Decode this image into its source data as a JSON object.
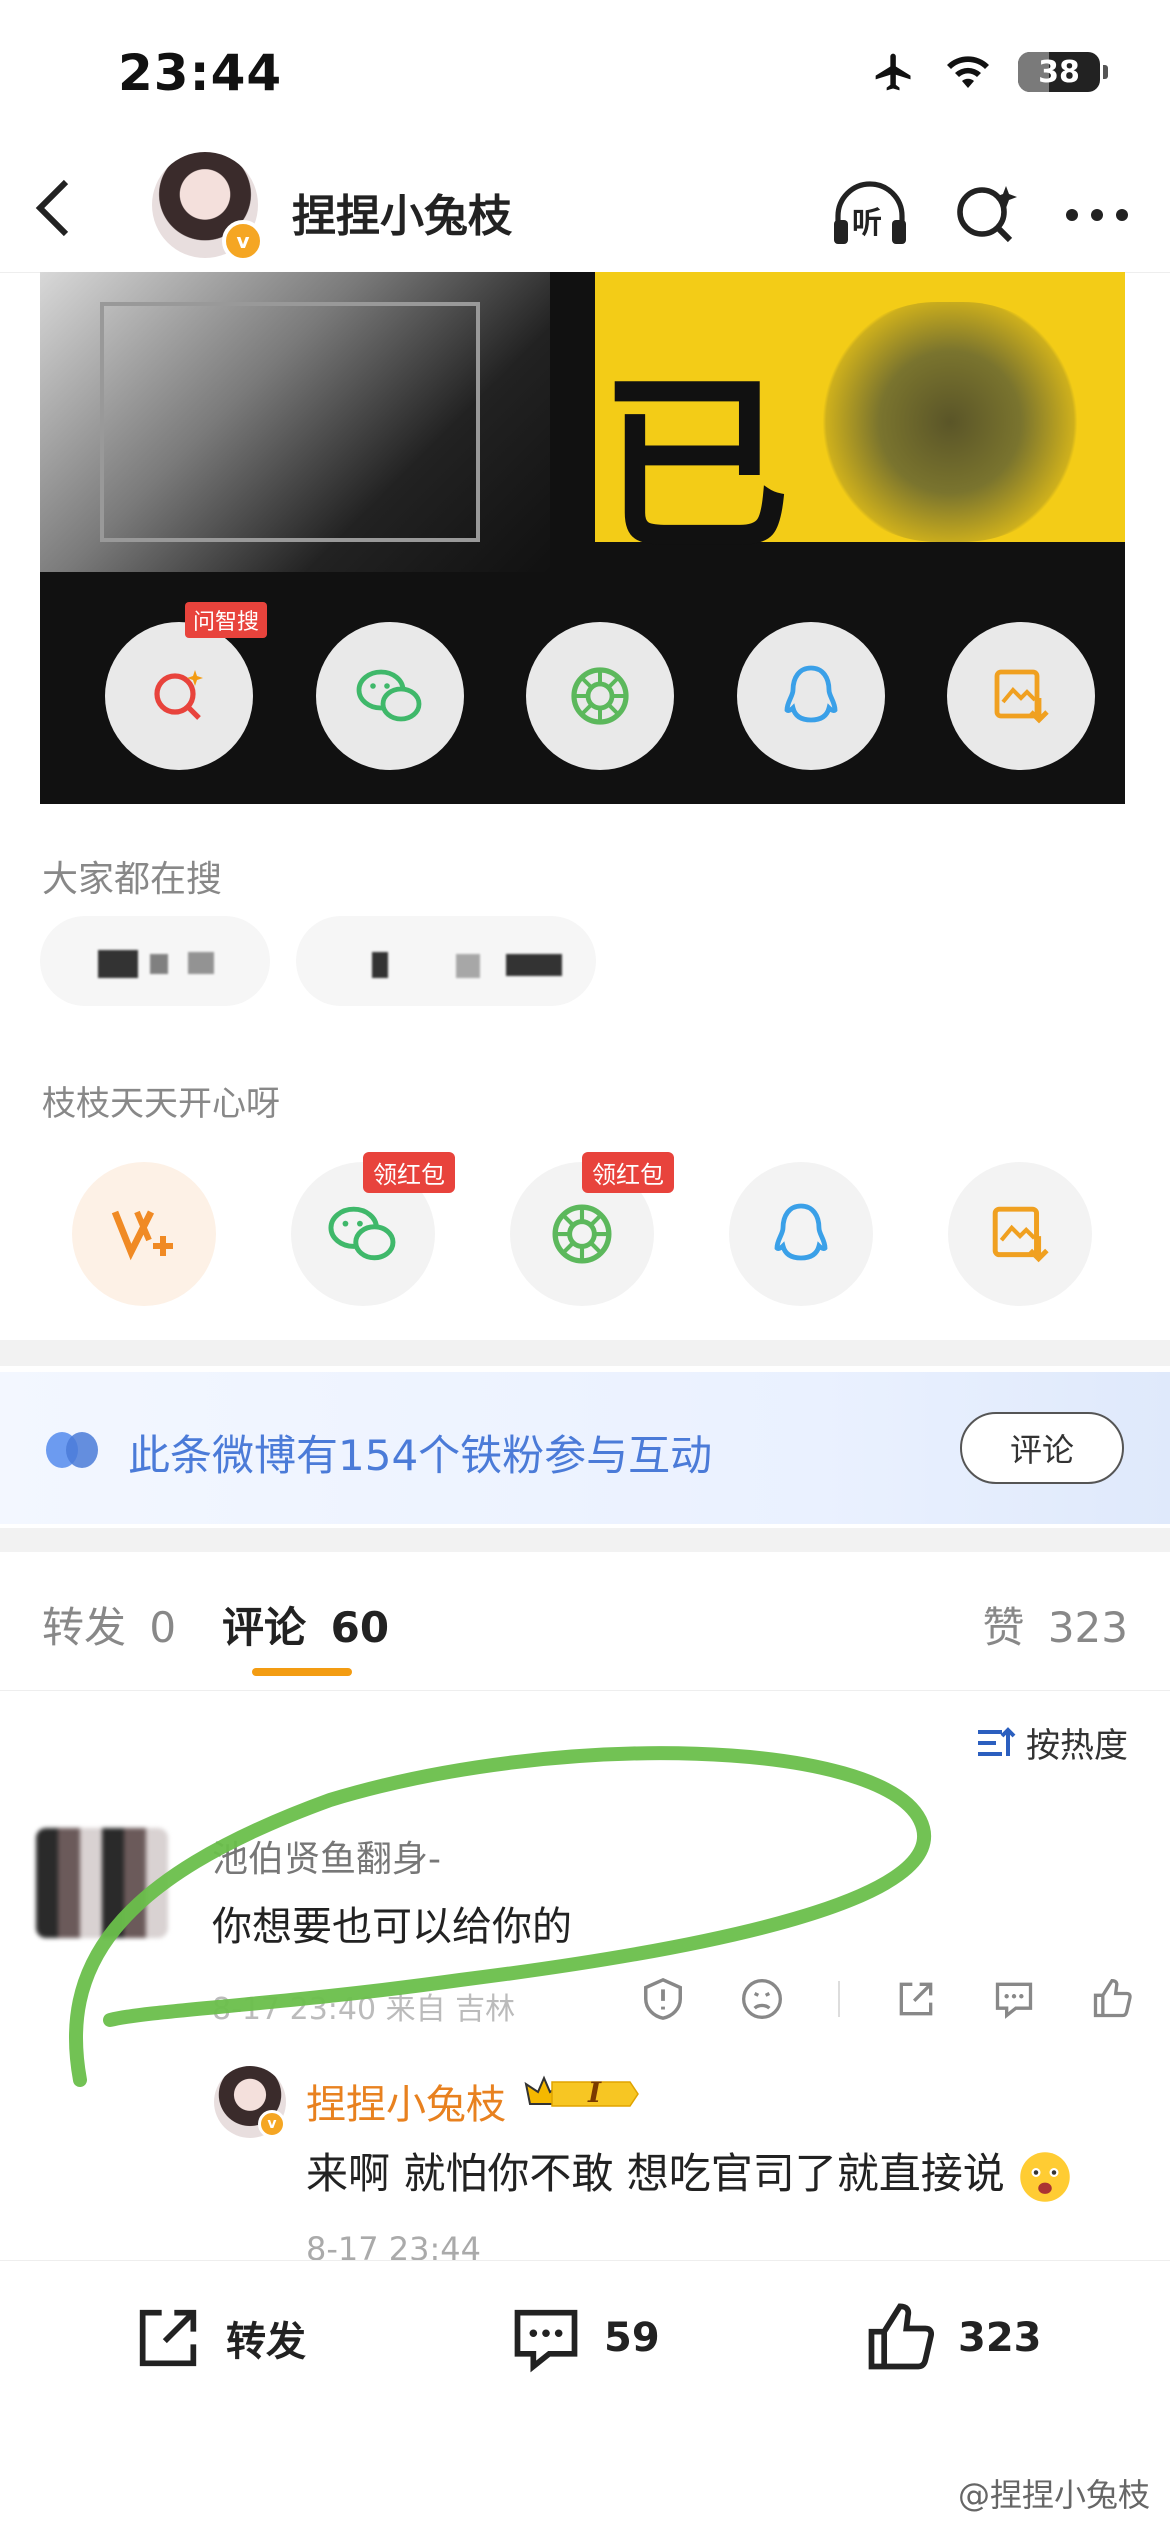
{
  "status_bar": {
    "time": "23:44",
    "battery": "38",
    "battery_level": 0.38
  },
  "header": {
    "username": "捏捏小兔枝",
    "verified_badge": "v",
    "icons": [
      "back-arrow-icon",
      "listen-icon",
      "ai-search-icon",
      "more-icon"
    ],
    "listen_label": "听"
  },
  "media": {
    "poster_text": "已",
    "share_tag": "问智搜",
    "share_icons": [
      "ai-search-icon",
      "wechat-icon",
      "moments-icon",
      "qq-icon",
      "save-image-icon"
    ]
  },
  "search_section": {
    "title": "大家都在搜"
  },
  "share_section": {
    "title": "枝枝天天开心呀",
    "items": [
      {
        "icon": "vplus-icon",
        "tag": ""
      },
      {
        "icon": "wechat-icon",
        "tag": "领红包"
      },
      {
        "icon": "moments-icon",
        "tag": "领红包"
      },
      {
        "icon": "qq-icon",
        "tag": ""
      },
      {
        "icon": "save-image-icon",
        "tag": ""
      }
    ]
  },
  "fans_banner": {
    "text": "此条微博有154个铁粉参与互动",
    "button": "评论"
  },
  "tabs": {
    "repost": {
      "label": "转发",
      "count": "0"
    },
    "comments": {
      "label": "评论",
      "count": "60"
    },
    "likes": {
      "label": "赞",
      "count": "323"
    }
  },
  "sort": {
    "label": "按热度"
  },
  "comment": {
    "name": "池伯贤鱼翻身-",
    "text": "你想要也可以给你的",
    "meta": "8-17 23:40 来自 吉林"
  },
  "reply": {
    "name": "捏捏小兔枝",
    "badge": "I",
    "text": "来啊 就怕你不敢 想吃官司了就直接说",
    "time": "8-17 23:44"
  },
  "bottom_bar": {
    "repost_label": "转发",
    "comment_count": "59",
    "like_count": "323"
  },
  "watermark": "@捏捏小兔枝",
  "colors": {
    "accent_orange": "#f39c12",
    "link_blue": "#4b7bd8",
    "red_tag": "#e8433c",
    "scribble_green": "#6abf4b"
  }
}
